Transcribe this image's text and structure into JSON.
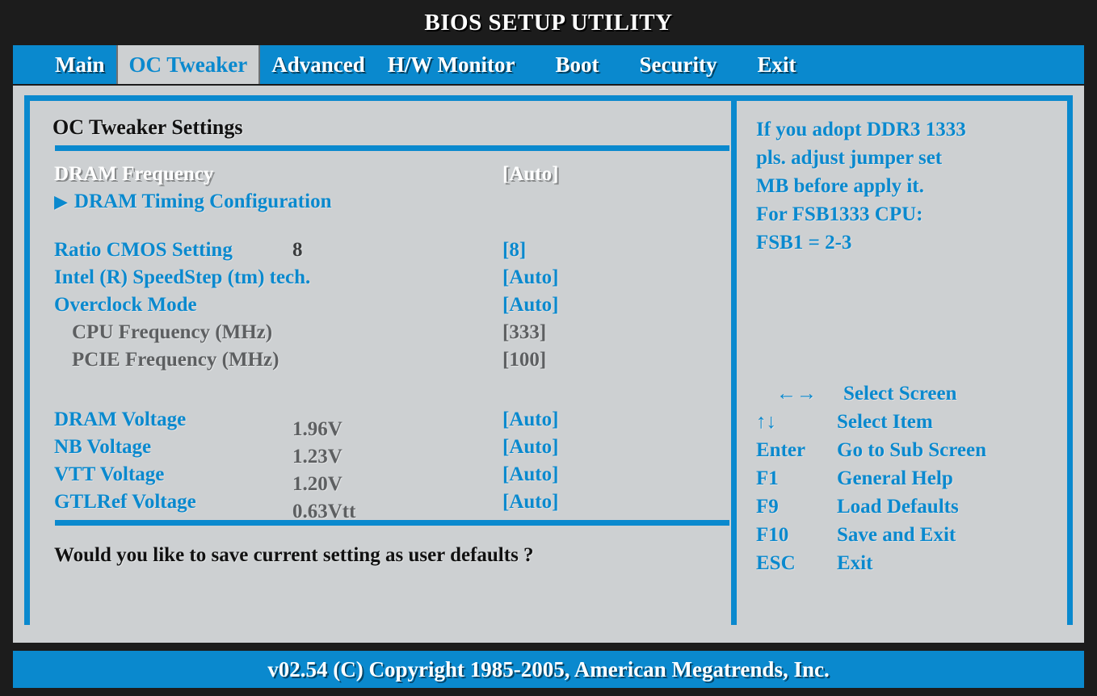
{
  "window": {
    "title": "BIOS SETUP UTILITY"
  },
  "tabs": [
    {
      "label": "Main",
      "active": false
    },
    {
      "label": "OC Tweaker",
      "active": true
    },
    {
      "label": "Advanced",
      "active": false
    },
    {
      "label": "H/W Monitor",
      "active": false
    },
    {
      "label": "Boot",
      "active": false
    },
    {
      "label": "Security",
      "active": false
    },
    {
      "label": "Exit",
      "active": false
    }
  ],
  "main": {
    "section_title": "OC Tweaker Settings",
    "items": {
      "dram_frequency_label": "DRAM Frequency",
      "dram_frequency_value": "[Auto]",
      "dram_timing_label": "DRAM Timing Configuration",
      "submenu_arrow": "▶",
      "ratio_cmos_label": "Ratio CMOS Setting",
      "ratio_cmos_current": "8",
      "ratio_cmos_value": "[8]",
      "speedstep_label": "Intel (R) SpeedStep (tm)  tech.",
      "speedstep_value": "[Auto]",
      "overclock_mode_label": "Overclock Mode",
      "overclock_mode_value": "[Auto]",
      "cpu_frequency_label": "CPU Frequency (MHz)",
      "cpu_frequency_value": "[333]",
      "pcie_frequency_label": "PCIE Frequency (MHz)",
      "pcie_frequency_value": "[100]",
      "dram_voltage_label": "DRAM Voltage",
      "dram_voltage_current": "1.96V",
      "dram_voltage_value": "[Auto]",
      "nb_voltage_label": "NB Voltage",
      "nb_voltage_current": "1.23V",
      "nb_voltage_value": "[Auto]",
      "vtt_voltage_label": "VTT Voltage",
      "vtt_voltage_current": "1.20V",
      "vtt_voltage_value": "[Auto]",
      "gtlref_voltage_label": "GTLRef Voltage",
      "gtlref_voltage_current": "0.63Vtt",
      "gtlref_voltage_value": "[Auto]"
    },
    "question": "Would you like to save current setting as user defaults ?"
  },
  "help": {
    "text": "If you adopt DDR3 1333 pls. adjust jumper set MB before apply it. For FSB1333 CPU: FSB1 = 2-3",
    "lines": [
      "If you adopt DDR3 1333",
      "pls. adjust jumper set",
      "MB before apply it.",
      "For FSB1333 CPU:",
      "FSB1 = 2-3"
    ],
    "keys": [
      {
        "key": "←→",
        "desc": "Select Screen"
      },
      {
        "key": "↑↓",
        "desc": "Select Item"
      },
      {
        "key": "Enter",
        "desc": "Go to Sub Screen"
      },
      {
        "key": "F1",
        "desc": "General Help"
      },
      {
        "key": "F9",
        "desc": "Load Defaults"
      },
      {
        "key": "F10",
        "desc": "Save and Exit"
      },
      {
        "key": "ESC",
        "desc": "Exit"
      }
    ]
  },
  "footer": {
    "text": "v02.54 (C) Copyright 1985-2005, American Megatrends, Inc."
  },
  "colors": {
    "accent_blue": "#0a89ce",
    "panel_gray": "#cdd0d2",
    "background_black": "#1c1c1c",
    "disabled_gray": "#5d5f61",
    "selected_white": "#ffffff"
  }
}
